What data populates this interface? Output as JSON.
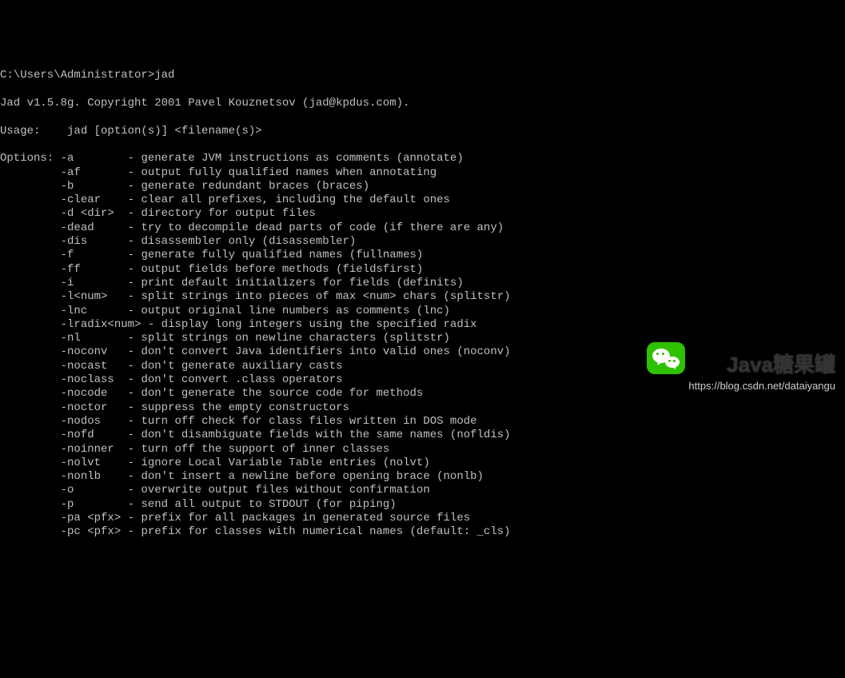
{
  "prompt": "C:\\Users\\Administrator>jad",
  "header": "Jad v1.5.8g. Copyright 2001 Pavel Kouznetsov (jad@kpdus.com).",
  "usage": "Usage:    jad [option(s)] <filename(s)>",
  "options_label": "Options: ",
  "options": [
    {
      "flag": "-a       ",
      "desc": "- generate JVM instructions as comments (annotate)"
    },
    {
      "flag": "-af      ",
      "desc": "- output fully qualified names when annotating"
    },
    {
      "flag": "-b       ",
      "desc": "- generate redundant braces (braces)"
    },
    {
      "flag": "-clear   ",
      "desc": "- clear all prefixes, including the default ones"
    },
    {
      "flag": "-d <dir> ",
      "desc": "- directory for output files"
    },
    {
      "flag": "-dead    ",
      "desc": "- try to decompile dead parts of code (if there are any)"
    },
    {
      "flag": "-dis     ",
      "desc": "- disassembler only (disassembler)"
    },
    {
      "flag": "-f       ",
      "desc": "- generate fully qualified names (fullnames)"
    },
    {
      "flag": "-ff      ",
      "desc": "- output fields before methods (fieldsfirst)"
    },
    {
      "flag": "-i       ",
      "desc": "- print default initializers for fields (definits)"
    },
    {
      "flag": "-l<num>  ",
      "desc": "- split strings into pieces of max <num> chars (splitstr)"
    },
    {
      "flag": "-lnc     ",
      "desc": "- output original line numbers as comments (lnc)"
    },
    {
      "flag": "-lradix<num>",
      "desc": "- display long integers using the specified radix"
    },
    {
      "flag": "-nl      ",
      "desc": "- split strings on newline characters (splitstr)"
    },
    {
      "flag": "-noconv  ",
      "desc": "- don't convert Java identifiers into valid ones (noconv)"
    },
    {
      "flag": "-nocast  ",
      "desc": "- don't generate auxiliary casts"
    },
    {
      "flag": "-noclass ",
      "desc": "- don't convert .class operators"
    },
    {
      "flag": "-nocode  ",
      "desc": "- don't generate the source code for methods"
    },
    {
      "flag": "-noctor  ",
      "desc": "- suppress the empty constructors"
    },
    {
      "flag": "-nodos   ",
      "desc": "- turn off check for class files written in DOS mode"
    },
    {
      "flag": "-nofd    ",
      "desc": "- don't disambiguate fields with the same names (nofldis)"
    },
    {
      "flag": "-noinner ",
      "desc": "- turn off the support of inner classes"
    },
    {
      "flag": "-nolvt   ",
      "desc": "- ignore Local Variable Table entries (nolvt)"
    },
    {
      "flag": "-nonlb   ",
      "desc": "- don't insert a newline before opening brace (nonlb)"
    },
    {
      "flag": "-o       ",
      "desc": "- overwrite output files without confirmation"
    },
    {
      "flag": "-p       ",
      "desc": "- send all output to STDOUT (for piping)"
    },
    {
      "flag": "-pa <pfx>",
      "desc": "- prefix for all packages in generated source files"
    },
    {
      "flag": "-pc <pfx>",
      "desc": "- prefix for classes with numerical names (default: _cls)"
    }
  ],
  "watermark": {
    "brand": "Java糖果罐",
    "url": "https://blog.csdn.net/dataiyangu"
  }
}
